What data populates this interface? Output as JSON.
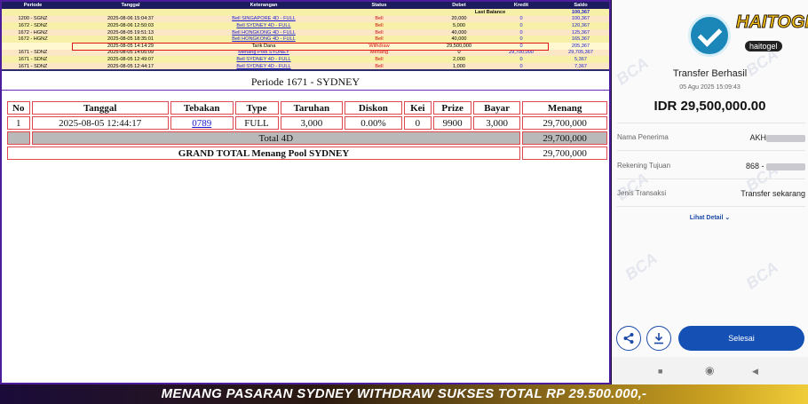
{
  "ledger": {
    "headers": [
      "Periode",
      "Tanggal",
      "Keterangan",
      "Status",
      "Debet",
      "Kredit",
      "Saldo"
    ],
    "last_balance_label": "Last Balance",
    "last_balance_value": "100,367",
    "rows": [
      {
        "periode": "1200 - SGNZ",
        "tanggal": "2025-08-06 15:04:37",
        "keterangan": "Bell SINGAPORE 4D - FULL",
        "status": "Bell",
        "debet": "20,000",
        "kredit": "0",
        "saldo": "100,367"
      },
      {
        "periode": "1672 - SDNZ",
        "tanggal": "2025-08-06 12:50:03",
        "keterangan": "Bell SYDNEY 4D - FULL",
        "status": "Bell",
        "debet": "5,000",
        "kredit": "0",
        "saldo": "120,367"
      },
      {
        "periode": "1672 - HGNZ",
        "tanggal": "2025-08-05 19:51:13",
        "keterangan": "Bell HONGKONG 4D - FULL",
        "status": "Bell",
        "debet": "40,000",
        "kredit": "0",
        "saldo": "125,367"
      },
      {
        "periode": "1672 - HGNZ",
        "tanggal": "2025-08-05 18:35:01",
        "keterangan": "Bell HONGKONG 4D - FULL",
        "status": "Bell",
        "debet": "40,000",
        "kredit": "0",
        "saldo": "165,367"
      },
      {
        "periode": "",
        "tanggal": "2025-08-05 14:14:29",
        "keterangan": "Tarik Dana",
        "status": "Withdraw",
        "debet": "29,500,000",
        "kredit": "0",
        "saldo": "205,367"
      },
      {
        "periode": "1671 - SDNZ",
        "tanggal": "2025-08-05 14:05:09",
        "keterangan": "Menang Pool SYDNEY",
        "status": "Menang",
        "debet": "0",
        "kredit": "29,700,000",
        "saldo": "29,705,367"
      },
      {
        "periode": "1671 - SDNZ",
        "tanggal": "2025-08-05 12:49:07",
        "keterangan": "Bell SYDNEY 4D - FULL",
        "status": "Bell",
        "debet": "2,000",
        "kredit": "0",
        "saldo": "5,367"
      },
      {
        "periode": "1671 - SDNZ",
        "tanggal": "2025-08-05 12:44:17",
        "keterangan": "Bell SYDNEY 4D - FULL",
        "status": "Bell",
        "debet": "1,000",
        "kredit": "0",
        "saldo": "7,367"
      }
    ]
  },
  "periode_title": "Periode 1671 - SYDNEY",
  "result_table": {
    "headers": [
      "No",
      "Tanggal",
      "Tebakan",
      "Type",
      "Taruhan",
      "Diskon",
      "Kei",
      "Prize",
      "Bayar",
      "Menang"
    ],
    "row": {
      "no": "1",
      "tanggal": "2025-08-05 12:44:17",
      "tebakan": "0789",
      "type": "FULL",
      "taruhan": "3,000",
      "diskon": "0.00%",
      "kei": "0",
      "prize": "9900",
      "bayar": "3,000",
      "menang": "29,700,000"
    },
    "total_label": "Total 4D",
    "total_value": "29,700,000",
    "grand_label": "GRAND TOTAL  Menang Pool SYDNEY",
    "grand_value": "29,700,000"
  },
  "receipt": {
    "watermark": "BCA",
    "logo_text": "HAITOGEL",
    "logo_sub": "haitogel",
    "title": "Transfer Berhasil",
    "date": "05 Agu 2025 15:09:43",
    "amount": "IDR 29,500,000.00",
    "recipient_label": "Nama Penerima",
    "recipient_value": "AKH",
    "account_label": "Rekening Tujuan",
    "account_value": "868 -",
    "type_label": "Jenis Transaksi",
    "type_value": "Transfer sekarang",
    "details_link": "Lihat Detail",
    "done_button": "Selesai",
    "icons": [
      "check-circle-icon",
      "share-icon",
      "download-icon",
      "chevron-down-icon"
    ],
    "colors": {
      "accent": "#1550b5",
      "check": "#1a87b8"
    }
  },
  "banner": {
    "text": "MENANG PASARAN SYDNEY WITHDRAW SUKSES TOTAL RP 29.500.000,-"
  }
}
